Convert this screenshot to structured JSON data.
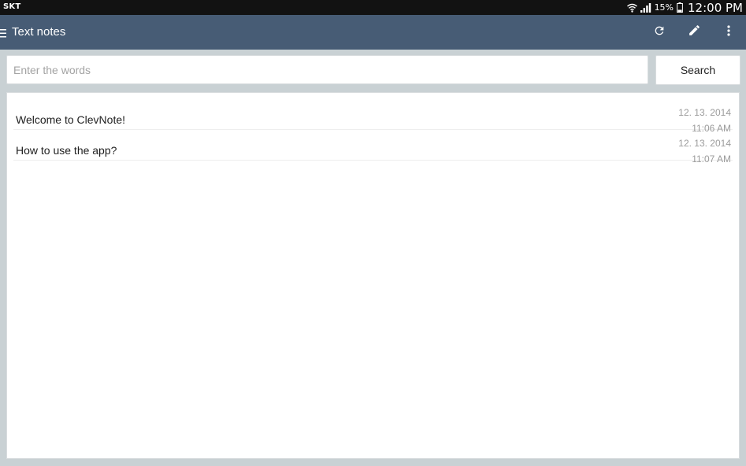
{
  "status_bar": {
    "carrier": "SKT",
    "battery_percent": "15%",
    "time": "12:00 PM",
    "icons": [
      "wifi-icon",
      "signal-icon",
      "battery-icon"
    ]
  },
  "app_bar": {
    "title": "Text notes",
    "background_color": "#475c75",
    "actions": [
      "refresh-icon",
      "edit-icon",
      "more-vert-icon"
    ]
  },
  "search": {
    "placeholder": "Enter the words",
    "value": "",
    "button_label": "Search"
  },
  "notes": [
    {
      "title": "Welcome to ClevNote!",
      "date": "12. 13. 2014",
      "time": "11:06 AM"
    },
    {
      "title": "How to use the app?",
      "date": "12. 13. 2014",
      "time": "11:07 AM"
    }
  ]
}
